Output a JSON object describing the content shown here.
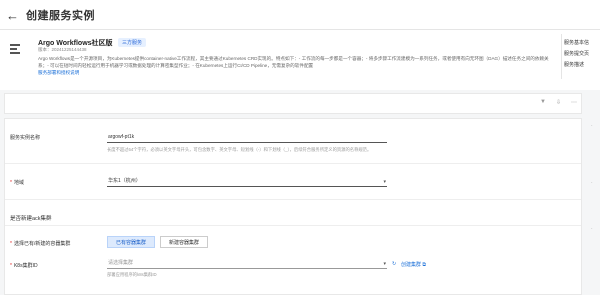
{
  "header": {
    "back_icon": "←",
    "title": "创建服务实例"
  },
  "service": {
    "name": "Argo Workflows社区版",
    "badge": "三方服务",
    "version": "版本：20241225144438",
    "description": "Argo Workflows是一个开源项目，为Kubernetes提供container-native工作流程，其主要通过Kubernetes CRD实现的。特点如下：- 工作流的每一步都是一个容器；- 将多步骤工作流建模为一系列任务，或者使用有向无环图（DAG）描述任务之间的依赖关系；- 可以在短时间内轻松运行用于机器学习或数据处理的计算密集型作业；- 在Kubernetes上运行CI/CD Pipeline，无需复杂的软件配置",
    "link": "服务部署和授权说明"
  },
  "side_links": [
    "服务基本信",
    "服务提交页",
    "服务描述"
  ],
  "toolbar": {
    "icons": [
      "filter-icon",
      "download-icon",
      "more-icon"
    ]
  },
  "form": {
    "instance_name": {
      "label": "服务实例名称",
      "value": "argowf-pt1k",
      "hint": "长度不超过64个字符，必须以英文字母开头，可包含数字、英文字母、短划线（-）和下划线（_），后续符合服务所定义的资源的名称规范。"
    },
    "region": {
      "label": "地域",
      "value": "华东1（杭州）"
    },
    "section_title": "是否新建ack集群",
    "cluster_choice": {
      "label": "选择已有/新建的容器集群",
      "options": [
        "已有容器集群",
        "新建容器集群"
      ],
      "selected": 0
    },
    "k8s_cluster": {
      "label": "K8s集群ID",
      "placeholder": "请选择集群",
      "hint": "部署应用程序的k8s集群ID",
      "create_link": "创建集群"
    }
  }
}
